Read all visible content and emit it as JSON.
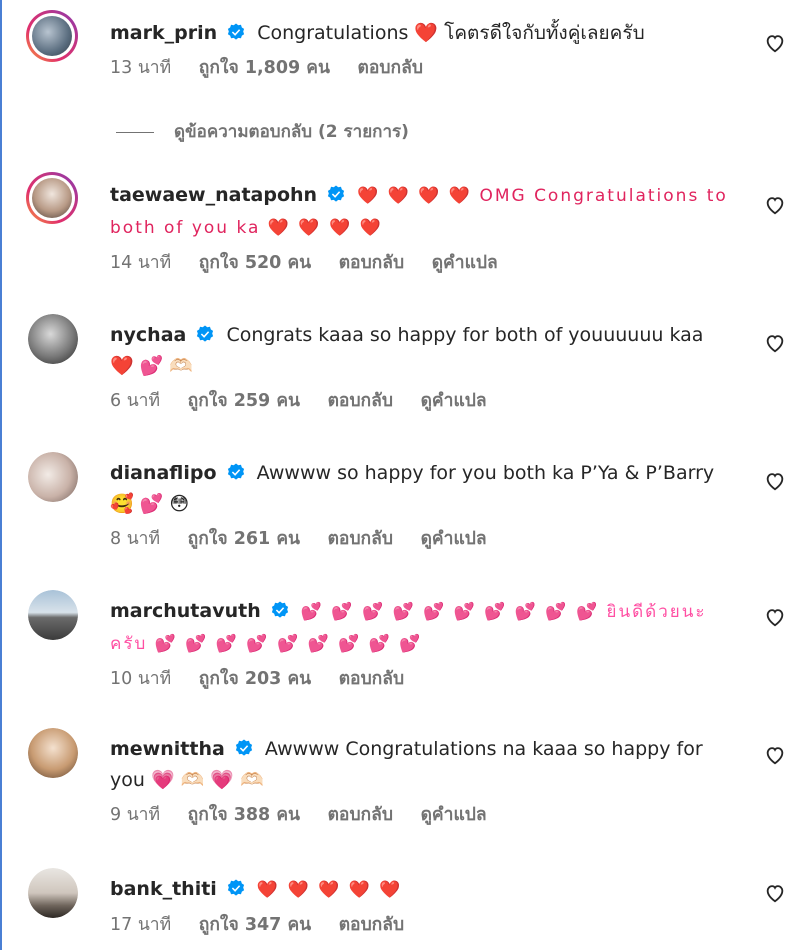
{
  "colors": {
    "accent": "#0095f6",
    "heart": "#e0245e",
    "secondary": "#737373",
    "pink": "#ff4fa3"
  },
  "comments": [
    {
      "username": "mark_prin",
      "text": "Congratulations ❤️ โคตรดีใจกับทั้งคู่เลยครับ",
      "time": "13 นาที",
      "likes": "ถูกใจ 1,809 คน",
      "reply": "ตอบกลับ",
      "translate": ""
    },
    {
      "username": "taewaew_natapohn",
      "text": "❤️ ❤️ ❤️ ❤️ OMG Congratulations to both of you ka ❤️ ❤️ ❤️ ❤️",
      "time": "14 นาที",
      "likes": "ถูกใจ 520 คน",
      "reply": "ตอบกลับ",
      "translate": "ดูคำแปล"
    },
    {
      "username": "nychaa",
      "text": "Congrats kaaa so happy for both of youuuuuu kaa ❤️ 💕 🫶🏻",
      "time": "6 นาที",
      "likes": "ถูกใจ 259 คน",
      "reply": "ตอบกลับ",
      "translate": "ดูคำแปล"
    },
    {
      "username": "dianaflipo",
      "text": "Awwww so happy for you both ka P’Ya & P’Barry 🥰 💕 😳",
      "time": "8 นาที",
      "likes": "ถูกใจ 261 คน",
      "reply": "ตอบกลับ",
      "translate": "ดูคำแปล"
    },
    {
      "username": "marchutavuth",
      "text": "💕 💕 💕 💕 💕 💕 💕 💕 💕 💕 ยินดีด้วยนะครับ 💕 💕 💕 💕 💕 💕 💕 💕 💕",
      "time": "10 นาที",
      "likes": "ถูกใจ 203 คน",
      "reply": "ตอบกลับ",
      "translate": ""
    },
    {
      "username": "mewnittha",
      "text": "Awwww Congratulations na kaaa so happy for you 💗 🫶🏻 💗 🫶🏻",
      "time": "9 นาที",
      "likes": "ถูกใจ 388 คน",
      "reply": "ตอบกลับ",
      "translate": "ดูคำแปล"
    },
    {
      "username": "bank_thiti",
      "text": "❤️ ❤️ ❤️ ❤️ ❤️",
      "time": "17 นาที",
      "likes": "ถูกใจ 347 คน",
      "reply": "ตอบกลับ",
      "translate": ""
    }
  ],
  "view_replies": "ดูข้อความตอบกลับ (2 รายการ)"
}
